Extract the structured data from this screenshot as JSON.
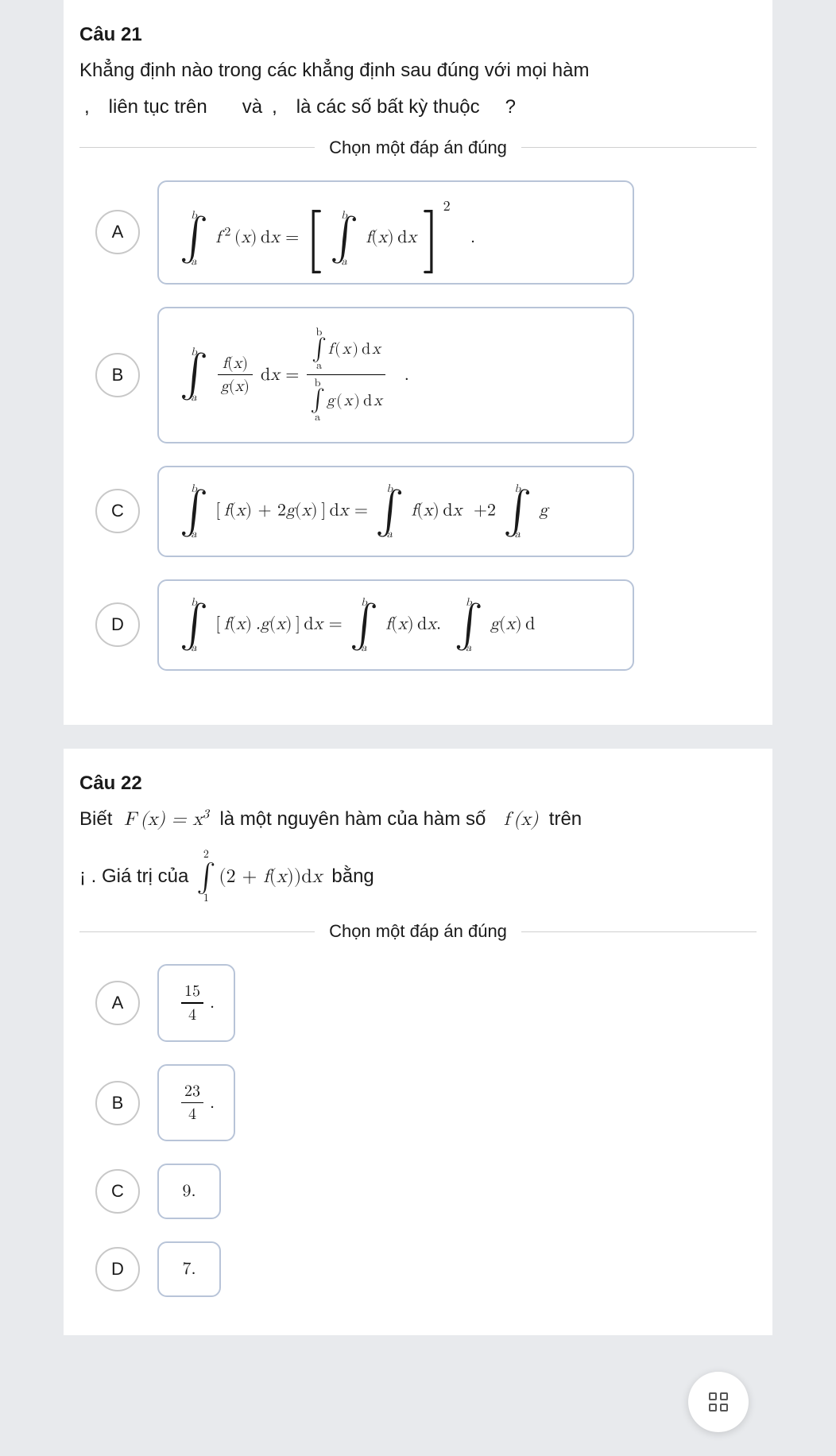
{
  "q21": {
    "title": "Câu 21",
    "text_line1": "Khẳng định nào trong các khẳng định sau đúng với mọi hàm",
    "text_line2_parts": {
      "p1": ",",
      "p2": "liên tục trên",
      "p3": "và",
      "p4": ",",
      "p5": "là các số bất kỳ thuộc",
      "p6": "?"
    },
    "instruction": "Chọn một đáp án đúng",
    "options": {
      "A": {
        "letter": "A",
        "formula_desc": "∫ₐᵇ f²(x) dx = [∫ₐᵇ f(x) dx]²  ."
      },
      "B": {
        "letter": "B",
        "formula_desc": "∫ₐᵇ f(x)/g(x) dx = (∫ₐᵇ f(x) dx) / (∫ₐᵇ g(x) dx)  ."
      },
      "C": {
        "letter": "C",
        "formula_desc": "∫ₐᵇ [f(x) + 2g(x)] dx = ∫ₐᵇ f(x) dx + 2 ∫ₐᵇ g  ."
      },
      "D": {
        "letter": "D",
        "formula_desc": "∫ₐᵇ [f(x)·g(x)] dx = ∫ₐᵇ f(x) dx · ∫ₐᵇ g(x) d  ."
      }
    }
  },
  "q22": {
    "title": "Câu 22",
    "text_pre": "Biết",
    "formula_F": "F(x) = x³",
    "text_mid": "là một nguyên hàm của hàm số",
    "formula_f": "f(x)",
    "text_post": "trên",
    "line2_pre": "¡  . Giá trị của",
    "formula_int": "∫₁² (2 + f(x)) dx",
    "line2_post": "bằng",
    "instruction": "Chọn một đáp án đúng",
    "options": {
      "A": {
        "letter": "A",
        "value_num": "15",
        "value_den": "4",
        "suffix": "."
      },
      "B": {
        "letter": "B",
        "value_num": "23",
        "value_den": "4",
        "suffix": "."
      },
      "C": {
        "letter": "C",
        "value": "9."
      },
      "D": {
        "letter": "D",
        "value": "7."
      }
    }
  }
}
